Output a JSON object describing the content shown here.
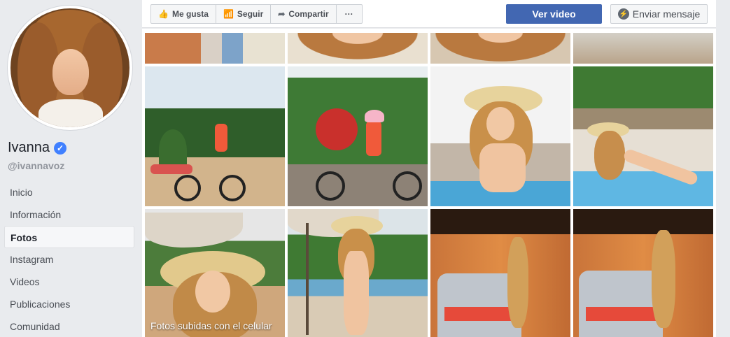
{
  "profile": {
    "name": "Ivanna",
    "handle": "@ivannavoz",
    "verified_icon": "verified-check-icon"
  },
  "nav": {
    "items": [
      {
        "label": "Inicio",
        "active": false
      },
      {
        "label": "Información",
        "active": false
      },
      {
        "label": "Fotos",
        "active": true
      },
      {
        "label": "Instagram",
        "active": false
      },
      {
        "label": "Videos",
        "active": false
      },
      {
        "label": "Publicaciones",
        "active": false
      },
      {
        "label": "Comunidad",
        "active": false
      }
    ]
  },
  "toolbar": {
    "like_label": "Me gusta",
    "follow_label": "Seguir",
    "share_label": "Compartir",
    "more_label": "···",
    "watch_label": "Ver video",
    "message_label": "Enviar mensaje"
  },
  "photos": {
    "album_caption": "Fotos subidas con el celular"
  },
  "colors": {
    "primary_blue": "#4267b2",
    "page_bg": "#e9ebee",
    "verified_blue": "#4080ff"
  }
}
